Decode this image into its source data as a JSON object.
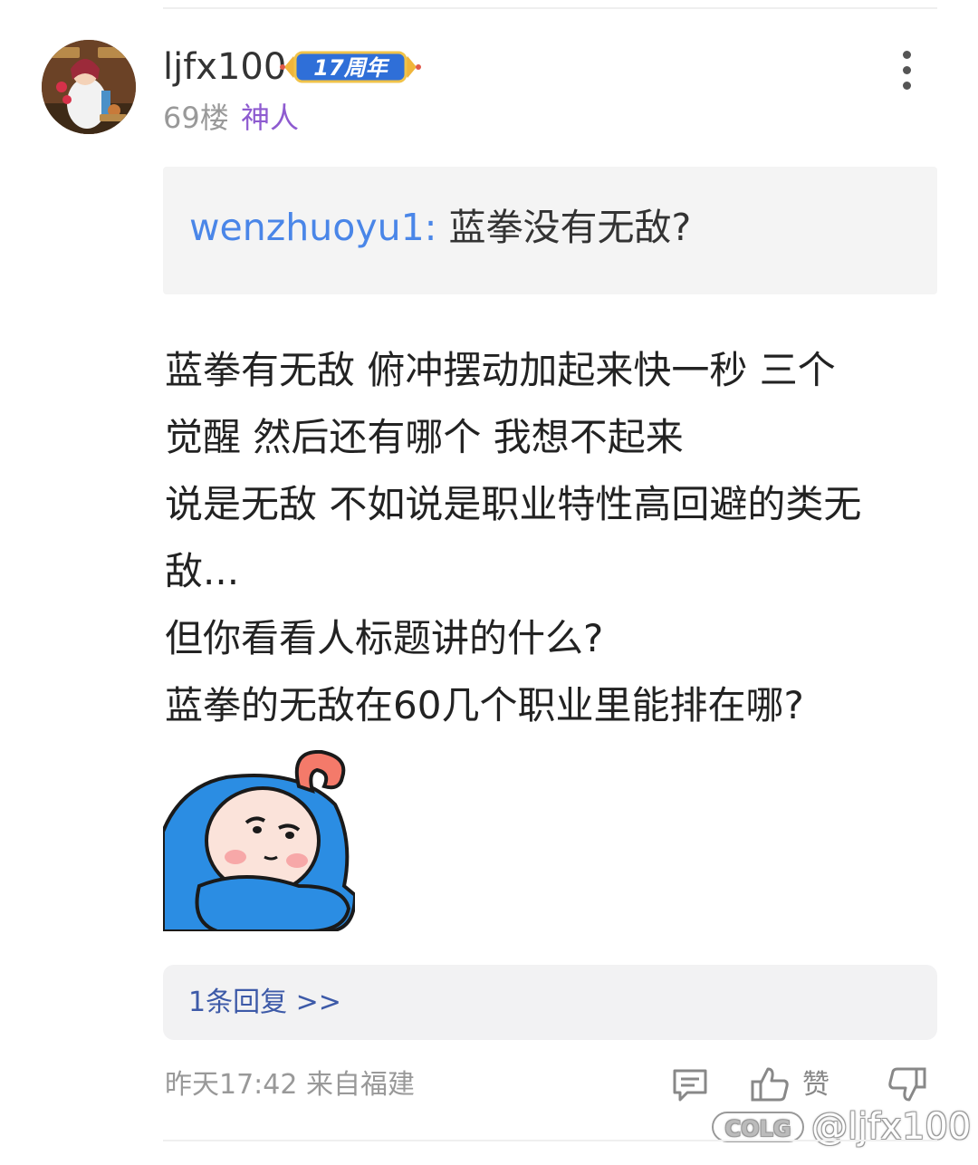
{
  "post": {
    "username": "ljfx100",
    "badge_text": "17周年",
    "floor": "69楼",
    "rank": "神人",
    "quote_author": "wenzhuoyu1:",
    "quote_text": "蓝拳没有无敌?",
    "body_lines": [
      "蓝拳有无敌 俯冲摆动加起来快一秒 三个",
      "觉醒 然后还有哪个 我想不起来",
      "说是无敌 不如说是职业特性高回避的类无",
      "敌...",
      "但你看看人标题讲的什么?",
      "蓝拳的无敌在60几个职业里能排在哪?"
    ],
    "replies_link": "1条回复 >>",
    "timestamp_location": "昨天17:42 来自福建",
    "like_label": "赞",
    "watermark_logo": "COLG",
    "watermark_handle": "@ljfx100"
  },
  "icons": {
    "more": "more-vertical-icon",
    "comment": "comment-icon",
    "like": "thumbs-up-icon",
    "dislike": "thumbs-down-icon"
  },
  "colors": {
    "quote_author": "#4a86e8",
    "rank": "#8e5bd0",
    "reply_link": "#3d5aa8",
    "meta_gray": "#999999"
  }
}
